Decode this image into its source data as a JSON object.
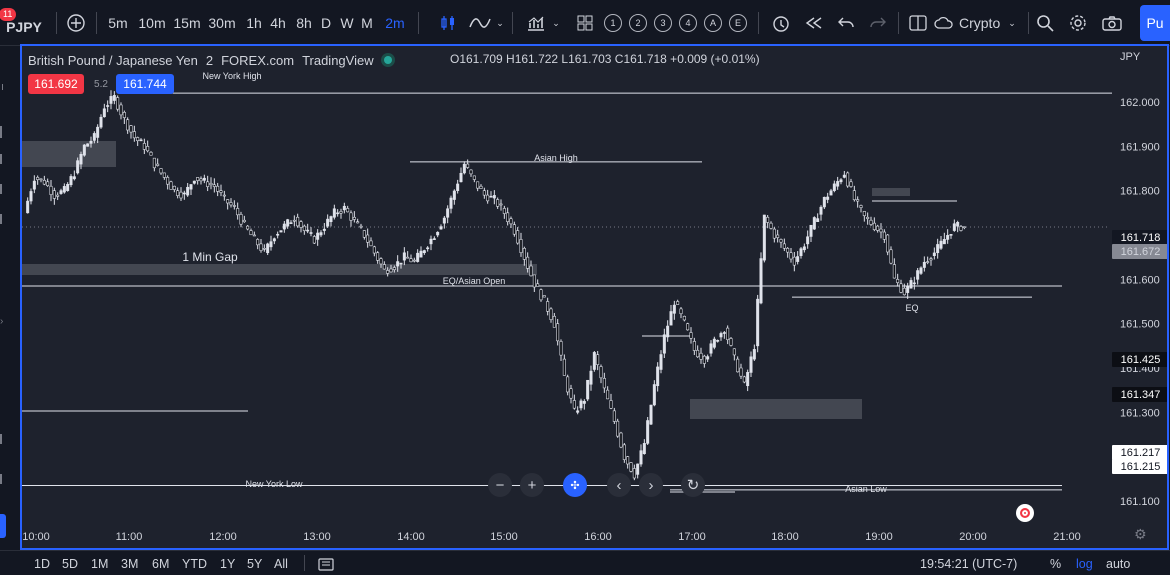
{
  "toolbar": {
    "symbol": "PJPY",
    "notification_count": "11",
    "intervals": [
      "5m",
      "10m",
      "15m",
      "30m",
      "1h",
      "4h",
      "8h",
      "D",
      "W",
      "M",
      "2m"
    ],
    "active_interval": "2m",
    "circle_buttons": [
      "1",
      "2",
      "3",
      "4",
      "A",
      "E"
    ],
    "crypto_label": "Crypto",
    "publish_label": "Pu"
  },
  "legend": {
    "name": "British Pound / Japanese Yen",
    "interval": "2",
    "exchange": "FOREX.com",
    "source": "TradingView",
    "ohlc": "O161.709 H161.722 L161.703 C161.718 +0.009 (+0.01%)"
  },
  "pills": {
    "sell": "161.692",
    "spread": "5.2",
    "buy": "161.744"
  },
  "chart_data": {
    "type": "candlestick",
    "y_axis": {
      "currency": "JPY",
      "ticks": [
        162.0,
        161.9,
        161.8,
        161.7,
        161.6,
        161.5,
        161.4,
        161.3,
        161.2,
        161.1
      ],
      "range": [
        161.06,
        162.07
      ]
    },
    "x_axis": {
      "ticks": [
        "10:00",
        "11:00",
        "12:00",
        "13:00",
        "14:00",
        "15:00",
        "16:00",
        "17:00",
        "18:00",
        "19:00",
        "20:00",
        "21:00"
      ]
    },
    "close_series": [
      161.75,
      161.83,
      161.82,
      161.79,
      161.8,
      161.84,
      161.9,
      161.92,
      161.99,
      162.01,
      161.96,
      161.92,
      161.9,
      161.86,
      161.83,
      161.8,
      161.79,
      161.83,
      161.82,
      161.81,
      161.78,
      161.76,
      161.72,
      161.69,
      161.66,
      161.7,
      161.72,
      161.74,
      161.71,
      161.69,
      161.72,
      161.75,
      161.76,
      161.73,
      161.7,
      161.66,
      161.62,
      161.63,
      161.65,
      161.64,
      161.67,
      161.7,
      161.74,
      161.8,
      161.86,
      161.82,
      161.79,
      161.78,
      161.75,
      161.71,
      161.65,
      161.59,
      161.55,
      161.5,
      161.38,
      161.3,
      161.33,
      161.43,
      161.35,
      161.28,
      161.2,
      161.16,
      161.23,
      161.36,
      161.47,
      161.55,
      161.5,
      161.44,
      161.42,
      161.46,
      161.49,
      161.42,
      161.36,
      161.45,
      161.74,
      161.7,
      161.67,
      161.64,
      161.68,
      161.73,
      161.78,
      161.81,
      161.84,
      161.78,
      161.74,
      161.72,
      161.7,
      161.6,
      161.57,
      161.6,
      161.64,
      161.66,
      161.69,
      161.72,
      161.718
    ],
    "annotations": [
      {
        "label": "New York High",
        "price": 162.02
      },
      {
        "label": "Asian High",
        "price": 161.865
      },
      {
        "label": "EQ/Asian Open",
        "price": 161.585
      },
      {
        "label": "EQ",
        "price": 161.56
      },
      {
        "label": "New York Low",
        "price": 161.135
      },
      {
        "label": "Asian Low",
        "price": 161.125
      },
      {
        "label": "1 Min Gap",
        "price": 161.69
      }
    ],
    "price_labels": [
      {
        "value": "161.718",
        "style": "last"
      },
      {
        "value": "161.672",
        "style": "grey"
      },
      {
        "value": "161.425",
        "style": "dark"
      },
      {
        "value": "161.347",
        "style": "dark"
      },
      {
        "value": "161.217",
        "style": "white"
      },
      {
        "value": "161.215",
        "style": "white"
      }
    ]
  },
  "bottom": {
    "ranges": [
      "1D",
      "5D",
      "1M",
      "3M",
      "6M",
      "YTD",
      "1Y",
      "5Y",
      "All"
    ],
    "clock": "19:54:21 (UTC-7)",
    "percent": "%",
    "log": "log",
    "auto": "auto"
  },
  "colors": {
    "accent": "#2962ff",
    "sell": "#f23645",
    "buy": "#2962ff",
    "background": "#1e222d"
  }
}
